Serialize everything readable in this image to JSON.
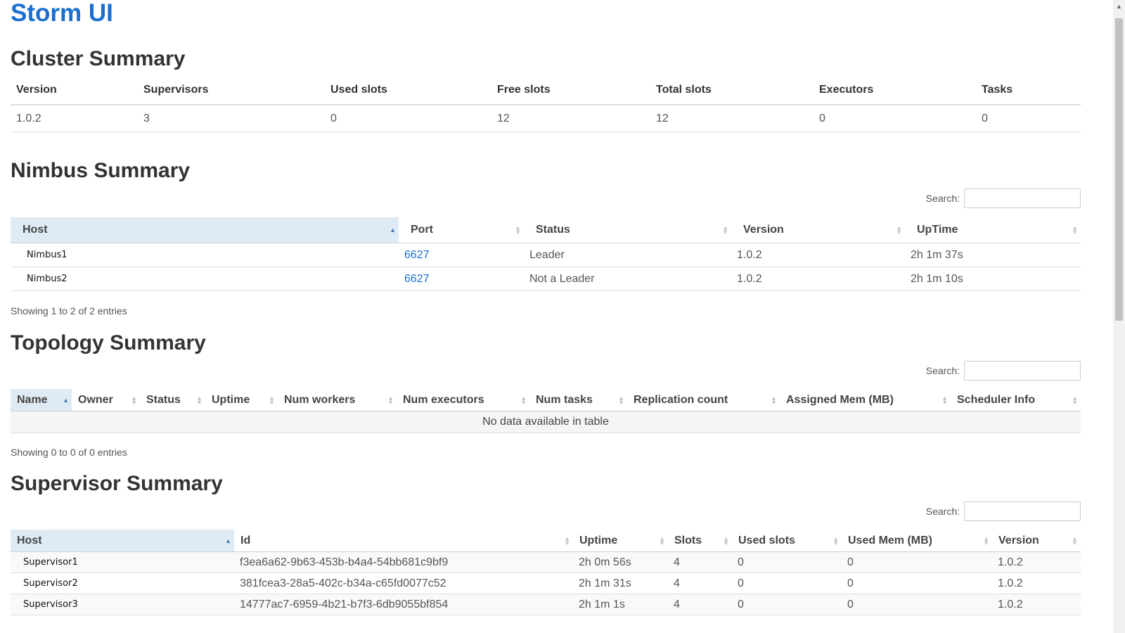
{
  "app_title": "Storm UI",
  "cluster": {
    "title": "Cluster Summary",
    "columns": [
      "Version",
      "Supervisors",
      "Used slots",
      "Free slots",
      "Total slots",
      "Executors",
      "Tasks"
    ],
    "row": [
      "1.0.2",
      "3",
      "0",
      "12",
      "12",
      "0",
      "0"
    ]
  },
  "nimbus": {
    "title": "Nimbus Summary",
    "search_label": "Search:",
    "columns": [
      "Host",
      "Port",
      "Status",
      "Version",
      "UpTime"
    ],
    "rows": [
      [
        "Nimbus1",
        "6627",
        "Leader",
        "1.0.2",
        "2h 1m 37s"
      ],
      [
        "Nimbus2",
        "6627",
        "Not a Leader",
        "1.0.2",
        "2h 1m 10s"
      ]
    ],
    "info": "Showing 1 to 2 of 2 entries"
  },
  "topology": {
    "title": "Topology Summary",
    "search_label": "Search:",
    "columns": [
      "Name",
      "Owner",
      "Status",
      "Uptime",
      "Num workers",
      "Num executors",
      "Num tasks",
      "Replication count",
      "Assigned Mem (MB)",
      "Scheduler Info"
    ],
    "empty": "No data available in table",
    "info": "Showing 0 to 0 of 0 entries"
  },
  "supervisor": {
    "title": "Supervisor Summary",
    "search_label": "Search:",
    "columns": [
      "Host",
      "Id",
      "Uptime",
      "Slots",
      "Used slots",
      "Used Mem (MB)",
      "Version"
    ],
    "rows": [
      [
        "Supervisor1",
        "f3ea6a62-9b63-453b-b4a4-54bb681c9bf9",
        "2h 0m 56s",
        "4",
        "0",
        "0",
        "1.0.2"
      ],
      [
        "Supervisor2",
        "381fcea3-28a5-402c-b34a-c65fd0077c52",
        "2h 1m 31s",
        "4",
        "0",
        "0",
        "1.0.2"
      ],
      [
        "Supervisor3",
        "14777ac7-6959-4b21-b7f3-6db9055bf854",
        "2h 1m 1s",
        "4",
        "0",
        "0",
        "1.0.2"
      ]
    ]
  },
  "icons": {
    "sort_asc": "sort-ascending-icon",
    "sort_both": "sort-both-icon"
  },
  "colors": {
    "link": "#1a6fd1",
    "sorted_header": "#deebf5"
  }
}
